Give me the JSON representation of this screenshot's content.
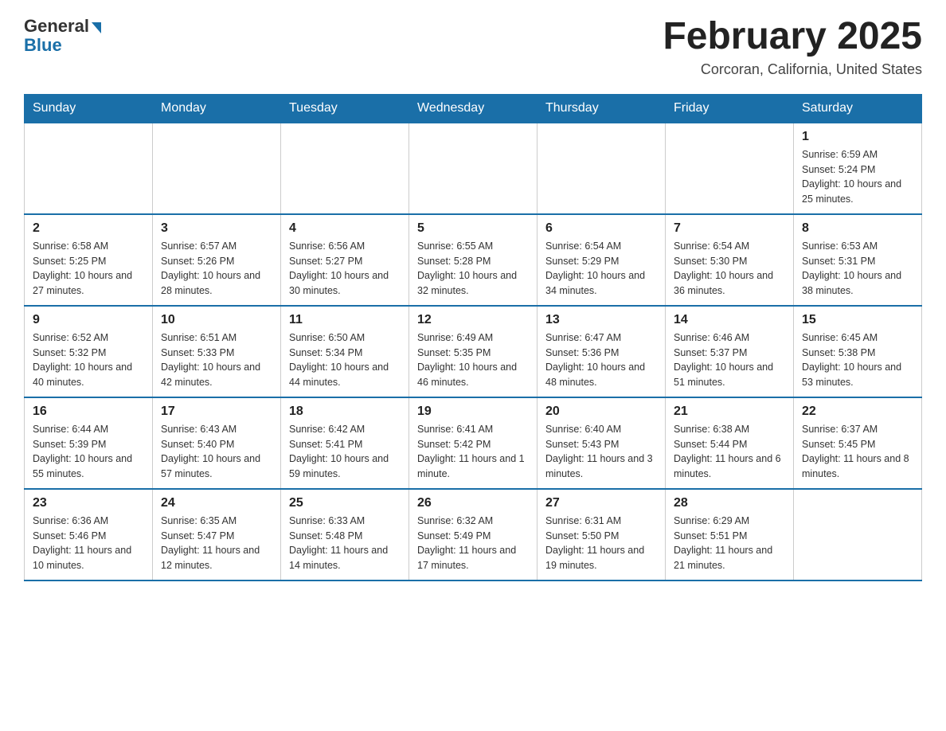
{
  "header": {
    "logo_general": "General",
    "logo_blue": "Blue",
    "month_title": "February 2025",
    "location": "Corcoran, California, United States"
  },
  "weekdays": [
    "Sunday",
    "Monday",
    "Tuesday",
    "Wednesday",
    "Thursday",
    "Friday",
    "Saturday"
  ],
  "weeks": [
    [
      {
        "day": "",
        "info": ""
      },
      {
        "day": "",
        "info": ""
      },
      {
        "day": "",
        "info": ""
      },
      {
        "day": "",
        "info": ""
      },
      {
        "day": "",
        "info": ""
      },
      {
        "day": "",
        "info": ""
      },
      {
        "day": "1",
        "info": "Sunrise: 6:59 AM\nSunset: 5:24 PM\nDaylight: 10 hours and 25 minutes."
      }
    ],
    [
      {
        "day": "2",
        "info": "Sunrise: 6:58 AM\nSunset: 5:25 PM\nDaylight: 10 hours and 27 minutes."
      },
      {
        "day": "3",
        "info": "Sunrise: 6:57 AM\nSunset: 5:26 PM\nDaylight: 10 hours and 28 minutes."
      },
      {
        "day": "4",
        "info": "Sunrise: 6:56 AM\nSunset: 5:27 PM\nDaylight: 10 hours and 30 minutes."
      },
      {
        "day": "5",
        "info": "Sunrise: 6:55 AM\nSunset: 5:28 PM\nDaylight: 10 hours and 32 minutes."
      },
      {
        "day": "6",
        "info": "Sunrise: 6:54 AM\nSunset: 5:29 PM\nDaylight: 10 hours and 34 minutes."
      },
      {
        "day": "7",
        "info": "Sunrise: 6:54 AM\nSunset: 5:30 PM\nDaylight: 10 hours and 36 minutes."
      },
      {
        "day": "8",
        "info": "Sunrise: 6:53 AM\nSunset: 5:31 PM\nDaylight: 10 hours and 38 minutes."
      }
    ],
    [
      {
        "day": "9",
        "info": "Sunrise: 6:52 AM\nSunset: 5:32 PM\nDaylight: 10 hours and 40 minutes."
      },
      {
        "day": "10",
        "info": "Sunrise: 6:51 AM\nSunset: 5:33 PM\nDaylight: 10 hours and 42 minutes."
      },
      {
        "day": "11",
        "info": "Sunrise: 6:50 AM\nSunset: 5:34 PM\nDaylight: 10 hours and 44 minutes."
      },
      {
        "day": "12",
        "info": "Sunrise: 6:49 AM\nSunset: 5:35 PM\nDaylight: 10 hours and 46 minutes."
      },
      {
        "day": "13",
        "info": "Sunrise: 6:47 AM\nSunset: 5:36 PM\nDaylight: 10 hours and 48 minutes."
      },
      {
        "day": "14",
        "info": "Sunrise: 6:46 AM\nSunset: 5:37 PM\nDaylight: 10 hours and 51 minutes."
      },
      {
        "day": "15",
        "info": "Sunrise: 6:45 AM\nSunset: 5:38 PM\nDaylight: 10 hours and 53 minutes."
      }
    ],
    [
      {
        "day": "16",
        "info": "Sunrise: 6:44 AM\nSunset: 5:39 PM\nDaylight: 10 hours and 55 minutes."
      },
      {
        "day": "17",
        "info": "Sunrise: 6:43 AM\nSunset: 5:40 PM\nDaylight: 10 hours and 57 minutes."
      },
      {
        "day": "18",
        "info": "Sunrise: 6:42 AM\nSunset: 5:41 PM\nDaylight: 10 hours and 59 minutes."
      },
      {
        "day": "19",
        "info": "Sunrise: 6:41 AM\nSunset: 5:42 PM\nDaylight: 11 hours and 1 minute."
      },
      {
        "day": "20",
        "info": "Sunrise: 6:40 AM\nSunset: 5:43 PM\nDaylight: 11 hours and 3 minutes."
      },
      {
        "day": "21",
        "info": "Sunrise: 6:38 AM\nSunset: 5:44 PM\nDaylight: 11 hours and 6 minutes."
      },
      {
        "day": "22",
        "info": "Sunrise: 6:37 AM\nSunset: 5:45 PM\nDaylight: 11 hours and 8 minutes."
      }
    ],
    [
      {
        "day": "23",
        "info": "Sunrise: 6:36 AM\nSunset: 5:46 PM\nDaylight: 11 hours and 10 minutes."
      },
      {
        "day": "24",
        "info": "Sunrise: 6:35 AM\nSunset: 5:47 PM\nDaylight: 11 hours and 12 minutes."
      },
      {
        "day": "25",
        "info": "Sunrise: 6:33 AM\nSunset: 5:48 PM\nDaylight: 11 hours and 14 minutes."
      },
      {
        "day": "26",
        "info": "Sunrise: 6:32 AM\nSunset: 5:49 PM\nDaylight: 11 hours and 17 minutes."
      },
      {
        "day": "27",
        "info": "Sunrise: 6:31 AM\nSunset: 5:50 PM\nDaylight: 11 hours and 19 minutes."
      },
      {
        "day": "28",
        "info": "Sunrise: 6:29 AM\nSunset: 5:51 PM\nDaylight: 11 hours and 21 minutes."
      },
      {
        "day": "",
        "info": ""
      }
    ]
  ]
}
